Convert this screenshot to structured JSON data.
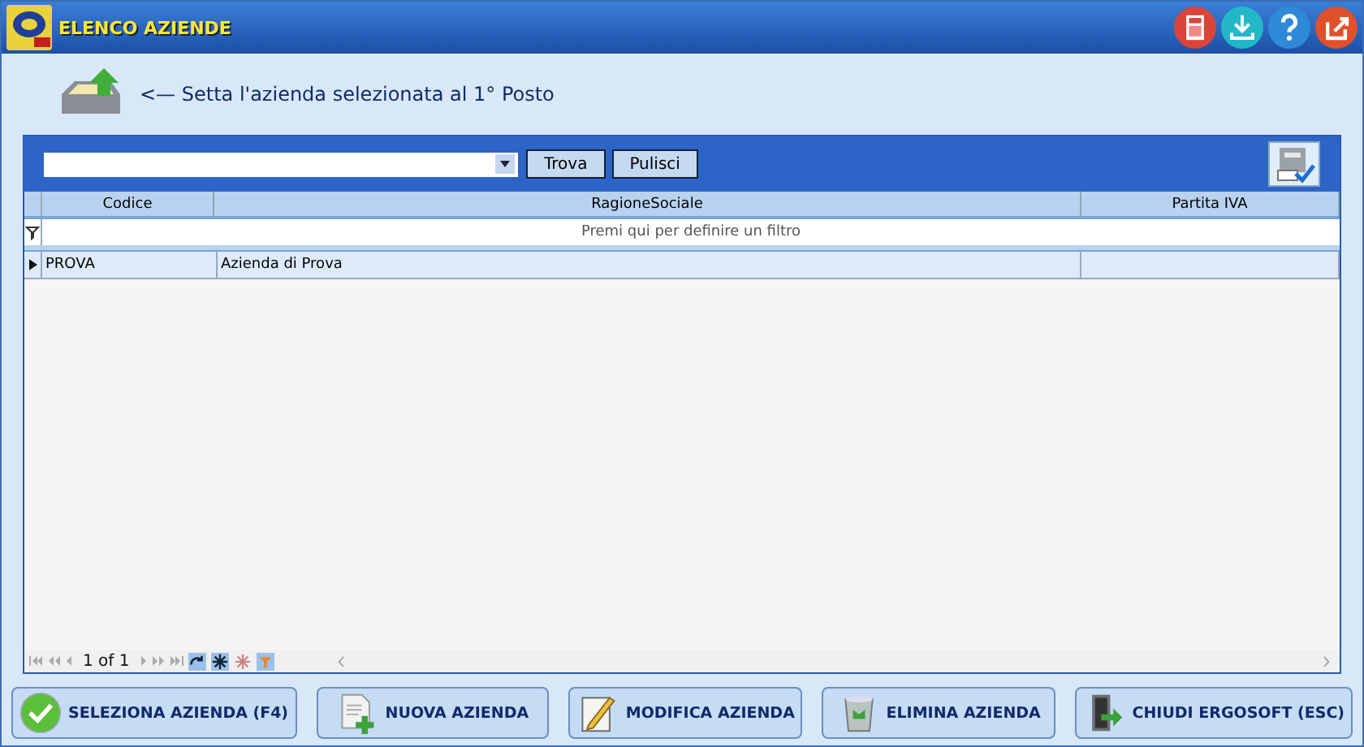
{
  "window": {
    "title": "ELENCO AZIENDE"
  },
  "hint": "<— Setta l'azienda selezionata al 1° Posto",
  "toolbar": {
    "buttons": [
      "Trova",
      "Pulisci"
    ]
  },
  "table": {
    "columns": [
      "Codice",
      "RagioneSociale",
      "Partita IVA"
    ],
    "filter_hint": "Premi qui per definire un filtro",
    "rows": [
      {
        "codice": "PROVA",
        "ragione_sociale": "Azienda di Prova",
        "selected": true
      }
    ]
  },
  "pager": {
    "position": "1 of 1"
  },
  "actions": [
    {
      "label": "SELEZIONA AZIENDA (F4)",
      "kind": "select"
    },
    {
      "label": "NUOVA AZIENDA",
      "kind": "new"
    },
    {
      "label": "MODIFICA AZIENDA",
      "kind": "edit"
    },
    {
      "label": "ELIMINA AZIENDA",
      "kind": "delete"
    },
    {
      "label": "CHIUDI ERGOSOFT (ESC)",
      "kind": "exit"
    }
  ]
}
